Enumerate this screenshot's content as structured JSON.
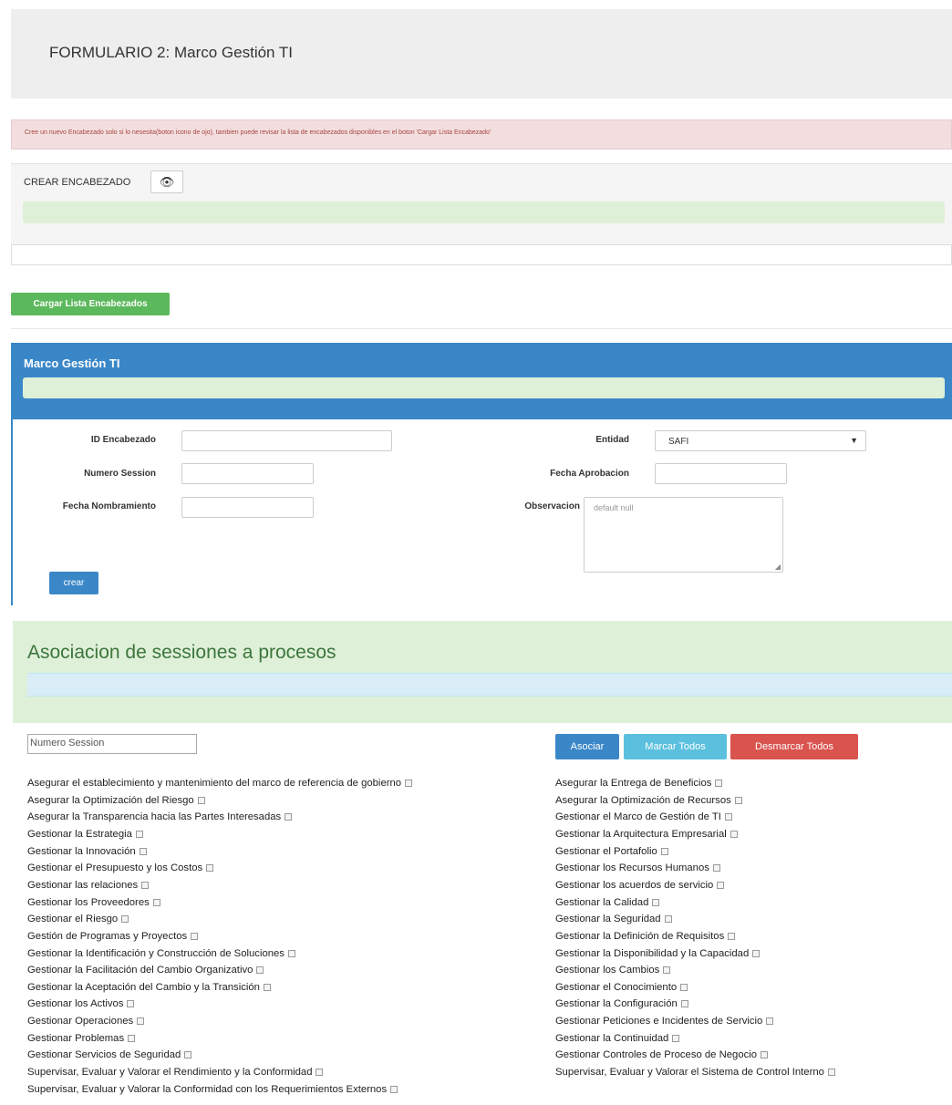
{
  "header": {
    "title": "FORMULARIO 2: Marco Gestión TI"
  },
  "alert": {
    "text": "Cree un nuevo Encabezado solo si lo nesesita(boton icono de ojo), tambien puede revisar la lista de encabezados disponibles en el boton 'Cargar Lista Encabezado'"
  },
  "encabezado": {
    "label": "CREAR ENCABEZADO",
    "eye_icon": "👁"
  },
  "cargar_button": "Cargar Lista Encabezados",
  "marco_panel": {
    "title": "Marco Gestión TI",
    "fields": {
      "id_encabezado": "ID Encabezado",
      "numero_session": "Numero Session",
      "fecha_nombramiento": "Fecha Nombramiento",
      "entidad": "Entidad",
      "entidad_value": "SAFI",
      "fecha_aprobacion": "Fecha Aprobacion",
      "observacion": "Observacion",
      "observacion_placeholder": "default null"
    },
    "crear_button": "crear"
  },
  "asociacion": {
    "title": "Asociacion de sessiones a procesos",
    "numero_session_value": "Numero Session",
    "buttons": {
      "asociar": "Asociar",
      "marcar": "Marcar Todos",
      "desmarcar": "Desmarcar Todos"
    },
    "left_processes": [
      "Asegurar el establecimiento y mantenimiento del marco de referencia de gobierno",
      "Asegurar la Optimización del Riesgo",
      "Asegurar la Transparencia hacia las Partes Interesadas",
      "Gestionar la Estrategia",
      "Gestionar la Innovación",
      "Gestionar el Presupuesto y los Costos",
      "Gestionar las relaciones",
      "Gestionar los Proveedores",
      "Gestionar el Riesgo",
      "Gestión de Programas y Proyectos",
      "Gestionar la Identificación y Construcción de Soluciones",
      "Gestionar la Facilitación del Cambio Organizativo",
      "Gestionar la Aceptación del Cambio y la Transición",
      "Gestionar los Activos",
      "Gestionar Operaciones",
      "Gestionar Problemas",
      "Gestionar Servicios de Seguridad",
      "Supervisar, Evaluar y Valorar el Rendimiento y la Conformidad",
      "Supervisar, Evaluar y Valorar la Conformidad con los Requerimientos Externos"
    ],
    "right_processes": [
      "Asegurar la Entrega de Beneficios",
      "Asegurar la Optimización de Recursos",
      "Gestionar el Marco de Gestión de TI",
      "Gestionar la Arquitectura Empresarial",
      "Gestionar el Portafolio",
      "Gestionar los Recursos Humanos",
      "Gestionar los acuerdos de servicio",
      "Gestionar la Calidad",
      "Gestionar la Seguridad",
      "Gestionar la Definición de Requisitos",
      "Gestionar la Disponibilidad y la Capacidad",
      "Gestionar los Cambios",
      "Gestionar el Conocimiento",
      "Gestionar la Configuración",
      "Gestionar Peticiones e Incidentes de Servicio",
      "Gestionar la Continuidad",
      "Gestionar Controles de Proceso de Negocio",
      "Supervisar, Evaluar y Valorar el Sistema de Control Interno"
    ]
  }
}
